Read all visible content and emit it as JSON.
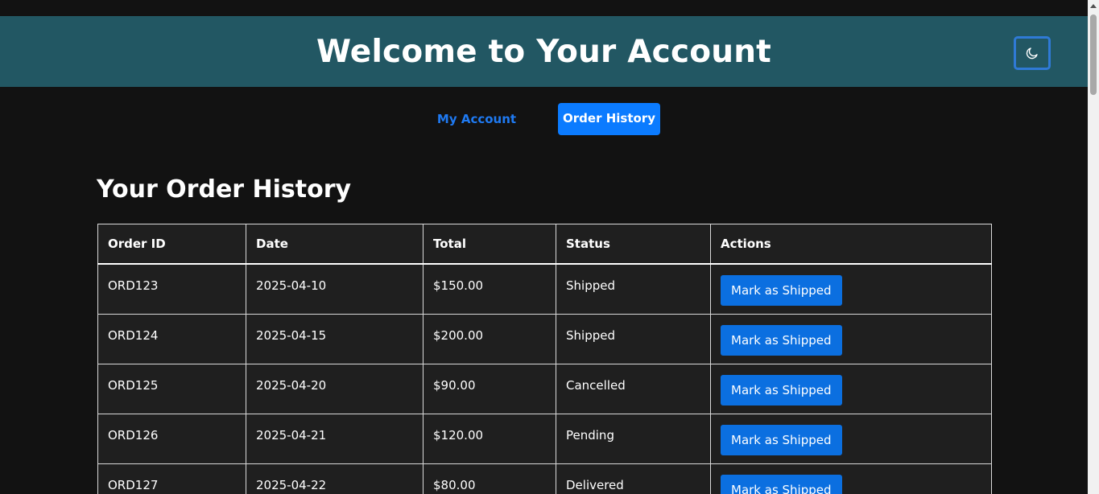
{
  "header": {
    "title": "Welcome to Your Account",
    "theme_toggle_icon": "moon-icon"
  },
  "tabs": [
    {
      "label": "My Account",
      "active": false
    },
    {
      "label": "Order History",
      "active": true
    }
  ],
  "main": {
    "title": "Your Order History",
    "table": {
      "columns": [
        "Order ID",
        "Date",
        "Total",
        "Status",
        "Actions"
      ],
      "rows": [
        {
          "id": "ORD123",
          "date": "2025-04-10",
          "total": "$150.00",
          "status": "Shipped",
          "action": "Mark as Shipped"
        },
        {
          "id": "ORD124",
          "date": "2025-04-15",
          "total": "$200.00",
          "status": "Shipped",
          "action": "Mark as Shipped"
        },
        {
          "id": "ORD125",
          "date": "2025-04-20",
          "total": "$90.00",
          "status": "Cancelled",
          "action": "Mark as Shipped"
        },
        {
          "id": "ORD126",
          "date": "2025-04-21",
          "total": "$120.00",
          "status": "Pending",
          "action": "Mark as Shipped"
        },
        {
          "id": "ORD127",
          "date": "2025-04-22",
          "total": "$80.00",
          "status": "Delivered",
          "action": "Mark as Shipped"
        }
      ]
    }
  },
  "colors": {
    "background": "#121212",
    "header": "#225763",
    "accent": "#0b7bff",
    "table_bg": "#1f1f1f"
  }
}
